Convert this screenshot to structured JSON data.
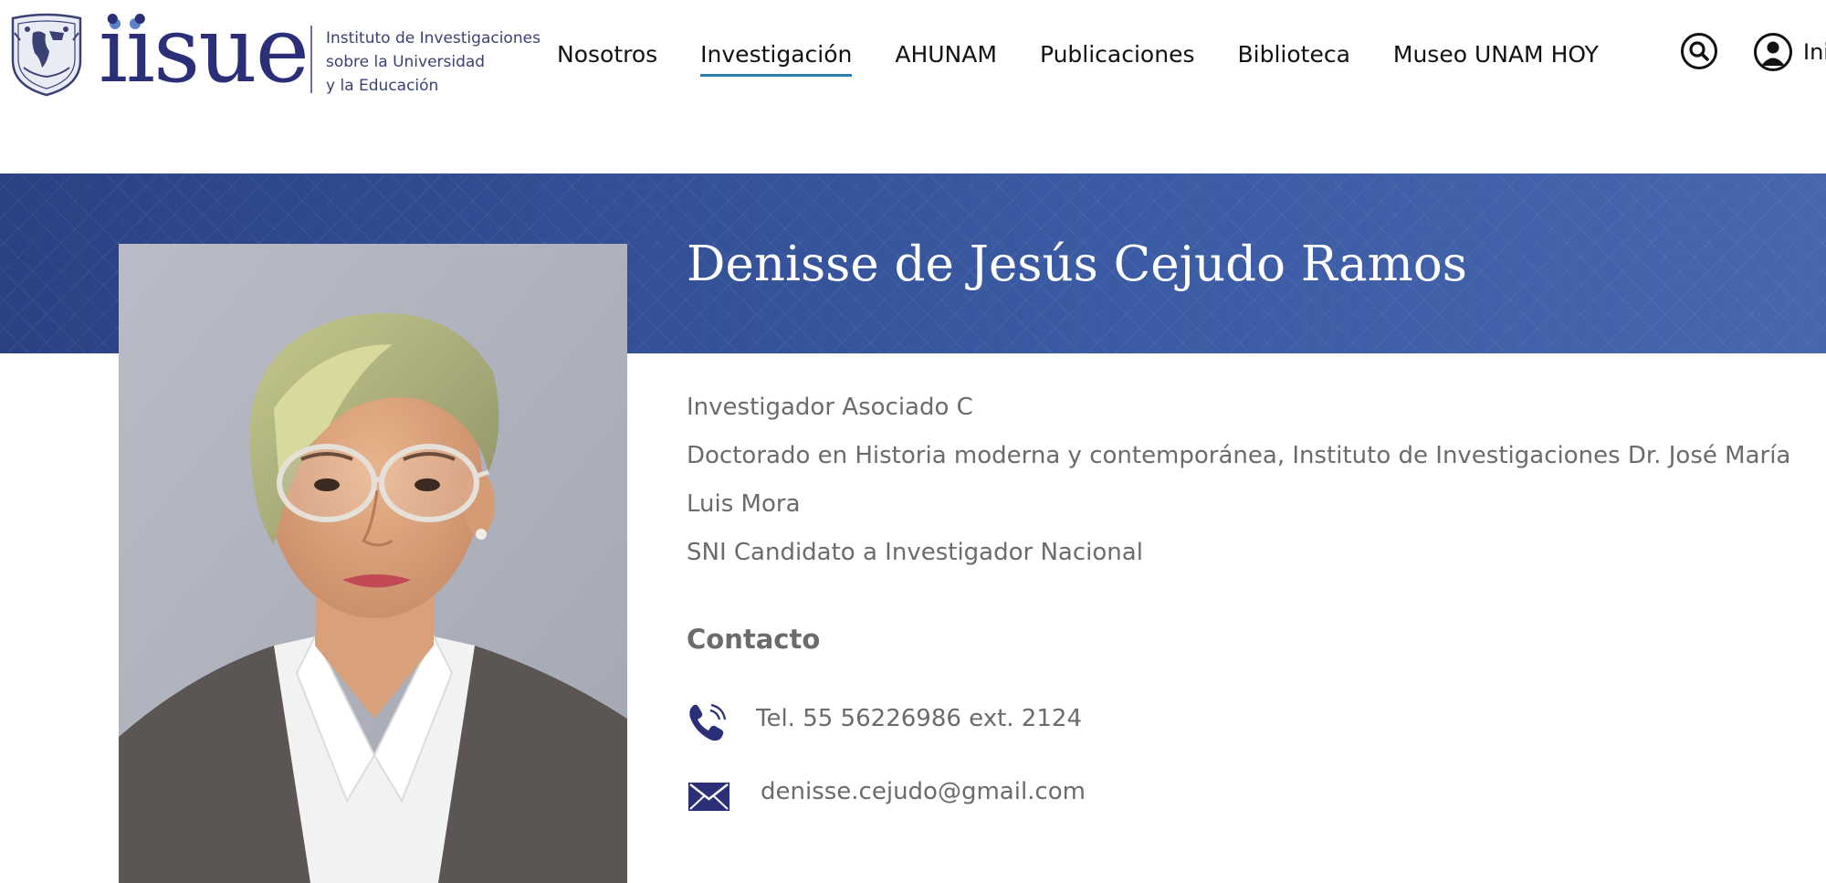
{
  "header": {
    "logo": {
      "wordmark": "iisue",
      "subtitle_lines": [
        "Instituto de Investigaciones",
        "sobre la Universidad",
        "y la Educación"
      ]
    },
    "nav": [
      {
        "label": "Nosotros",
        "active": false
      },
      {
        "label": "Investigación",
        "active": true
      },
      {
        "label": "AHUNAM",
        "active": false
      },
      {
        "label": "Publicaciones",
        "active": false
      },
      {
        "label": "Biblioteca",
        "active": false
      },
      {
        "label": "Museo UNAM HOY",
        "active": false
      }
    ],
    "search_icon": "search-icon",
    "user_icon": "user-circle-icon",
    "user_label": "Ini"
  },
  "profile": {
    "name": "Denisse de Jesús Cejudo Ramos",
    "details": [
      "Investigador Asociado C",
      "Doctorado en Historia moderna y contemporánea, Instituto de Investigaciones Dr. José María Luis Mora",
      "SNI Candidato a Investigador Nacional"
    ],
    "contact": {
      "title": "Contacto",
      "phone": "Tel. 55 56226986 ext. 2124",
      "email": "denisse.cejudo@gmail.com"
    }
  },
  "colors": {
    "brand_navy": "#2a2f78",
    "brand_light_blue": "#5b82c9",
    "banner_blue": "#2d4a8e",
    "nav_active_underline": "#2a7fae",
    "body_text": "#6b6b6b"
  }
}
